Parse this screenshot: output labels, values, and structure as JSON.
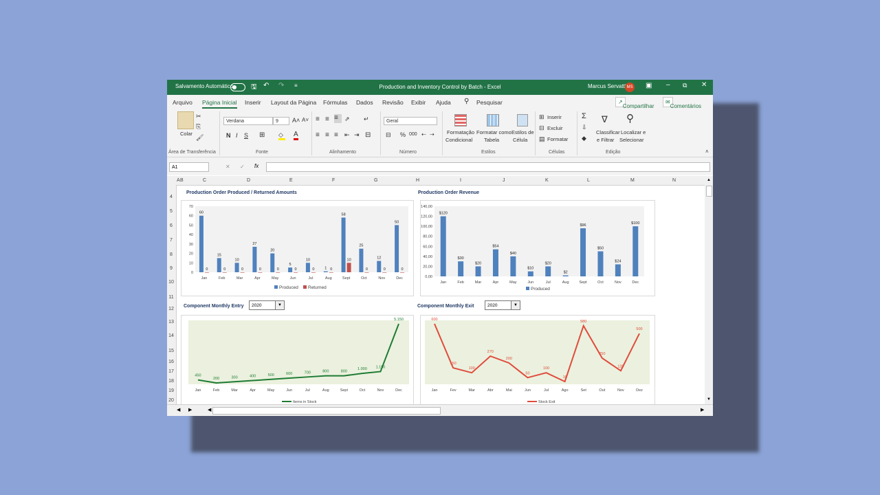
{
  "titlebar": {
    "autosave": "Salvamento Automático",
    "title": "Production and Inventory Control by Batch  -  Excel",
    "user": "Marcus Servatti",
    "avatar": "MS"
  },
  "menu": {
    "tabs": [
      "Arquivo",
      "Página Inicial",
      "Inserir",
      "Layout da Página",
      "Fórmulas",
      "Dados",
      "Revisão",
      "Exibir",
      "Ajuda"
    ],
    "search": "Pesquisar",
    "share": "Compartilhar",
    "comments": "Comentários"
  },
  "ribbon": {
    "paste": "Colar",
    "clipboard": "Área de Transferência",
    "font_name": "Verdana",
    "font_size": "9",
    "font_group": "Fonte",
    "align_group": "Alinhamento",
    "number_format": "Geral",
    "number_group": "Número",
    "cond_format_1": "Formatação",
    "cond_format_2": "Condicional",
    "table_format_1": "Formatar como",
    "table_format_2": "Tabela",
    "cell_styles_1": "Estilos de",
    "cell_styles_2": "Célula",
    "styles_group": "Estilos",
    "insert": "Inserir",
    "delete": "Excluir",
    "format": "Formatar",
    "cells_group": "Células",
    "sort_1": "Classificar",
    "sort_2": "e Filtrar",
    "find_1": "Localizar e",
    "find_2": "Selecionar",
    "edit_group": "Edição",
    "bold": "N",
    "italic": "I",
    "underline": "S"
  },
  "formula_bar": {
    "name_box": "A1",
    "fx": "fx",
    "value": ""
  },
  "sheet": {
    "columns": [
      "A",
      "B",
      "C",
      "D",
      "E",
      "F",
      "G",
      "H",
      "I",
      "J",
      "K",
      "L",
      "M",
      "N"
    ],
    "rows": [
      "4",
      "5",
      "6",
      "7",
      "8",
      "9",
      "10",
      "11",
      "12",
      "13",
      "14",
      "15",
      "16",
      "17",
      "18",
      "19",
      "20"
    ]
  },
  "dropdowns": {
    "entry_year": "2020",
    "exit_year": "2020"
  },
  "chart_data": [
    {
      "type": "bar",
      "title": "Production Order Produced / Returned Amounts",
      "categories": [
        "Jan",
        "Feb",
        "Mar",
        "Apr",
        "May",
        "Jun",
        "Jul",
        "Aug",
        "Sept",
        "Oct",
        "Nov",
        "Dec"
      ],
      "series": [
        {
          "name": "Produced",
          "values": [
            60,
            15,
            10,
            27,
            20,
            5,
            10,
            1,
            58,
            25,
            12,
            50
          ],
          "color": "#4f81bd"
        },
        {
          "name": "Returned",
          "values": [
            0,
            0,
            0,
            0,
            0,
            0,
            0,
            0,
            10,
            0,
            0,
            0
          ],
          "color": "#c0504d"
        }
      ],
      "ylim": [
        0,
        70
      ],
      "yticks": [
        "0",
        "10",
        "20",
        "30",
        "40",
        "50",
        "60",
        "70"
      ],
      "legend": "bottom",
      "grid": false
    },
    {
      "type": "bar",
      "title": "Production Order Revenue",
      "categories": [
        "Jan",
        "Feb",
        "Mar",
        "Apr",
        "May",
        "Jun",
        "Jul",
        "Aug",
        "Sept",
        "Oct",
        "Nov",
        "Dec"
      ],
      "series": [
        {
          "name": "Produced",
          "values": [
            120,
            30,
            20,
            54,
            40,
            10,
            20,
            2,
            96,
            50,
            24,
            100
          ],
          "color": "#4f81bd"
        }
      ],
      "labels": [
        "$120",
        "$30",
        "$20",
        "$54",
        "$40",
        "$10",
        "$20",
        "$2",
        "$96",
        "$50",
        "$24",
        "$100"
      ],
      "ylim": [
        0,
        140
      ],
      "yticks": [
        "0,00",
        "20,00",
        "40,00",
        "60,00",
        "80,00",
        "100,00",
        "120,00",
        "140,00"
      ],
      "legend": "bottom",
      "grid": false
    },
    {
      "type": "line",
      "title": "Component Monthly Entry",
      "categories": [
        "Jan",
        "Feb",
        "Mar",
        "Apr",
        "May",
        "Jun",
        "Jul",
        "Aug",
        "Sept",
        "Oct",
        "Nov",
        "Dec"
      ],
      "series": [
        {
          "name": "Items in Stock",
          "values": [
            450,
            200,
            300,
            400,
            500,
            600,
            700,
            800,
            800,
            1000,
            1150,
            5150
          ],
          "color": "#1e7b34"
        }
      ],
      "labels": [
        "450",
        "200",
        "300",
        "400",
        "500",
        "600",
        "700",
        "800",
        "800",
        "1.000",
        "1.150",
        "5.150"
      ],
      "legend": "bottom",
      "grid": false
    },
    {
      "type": "line",
      "title": "Component Monthly Exit",
      "categories": [
        "Jan",
        "Fev",
        "Mar",
        "Abr",
        "Mai",
        "Jun",
        "Jul",
        "Ago",
        "Set",
        "Out",
        "Nov",
        "Dez"
      ],
      "series": [
        {
          "name": "Stock Exit",
          "values": [
            600,
            150,
            100,
            270,
            200,
            50,
            100,
            10,
            580,
            250,
            120,
            500
          ],
          "color": "#e04b3c"
        }
      ],
      "labels": [
        "600",
        "150",
        "100",
        "270",
        "200",
        "50",
        "100",
        "10",
        "580",
        "250",
        "120",
        "500"
      ],
      "legend": "bottom",
      "grid": false
    }
  ]
}
